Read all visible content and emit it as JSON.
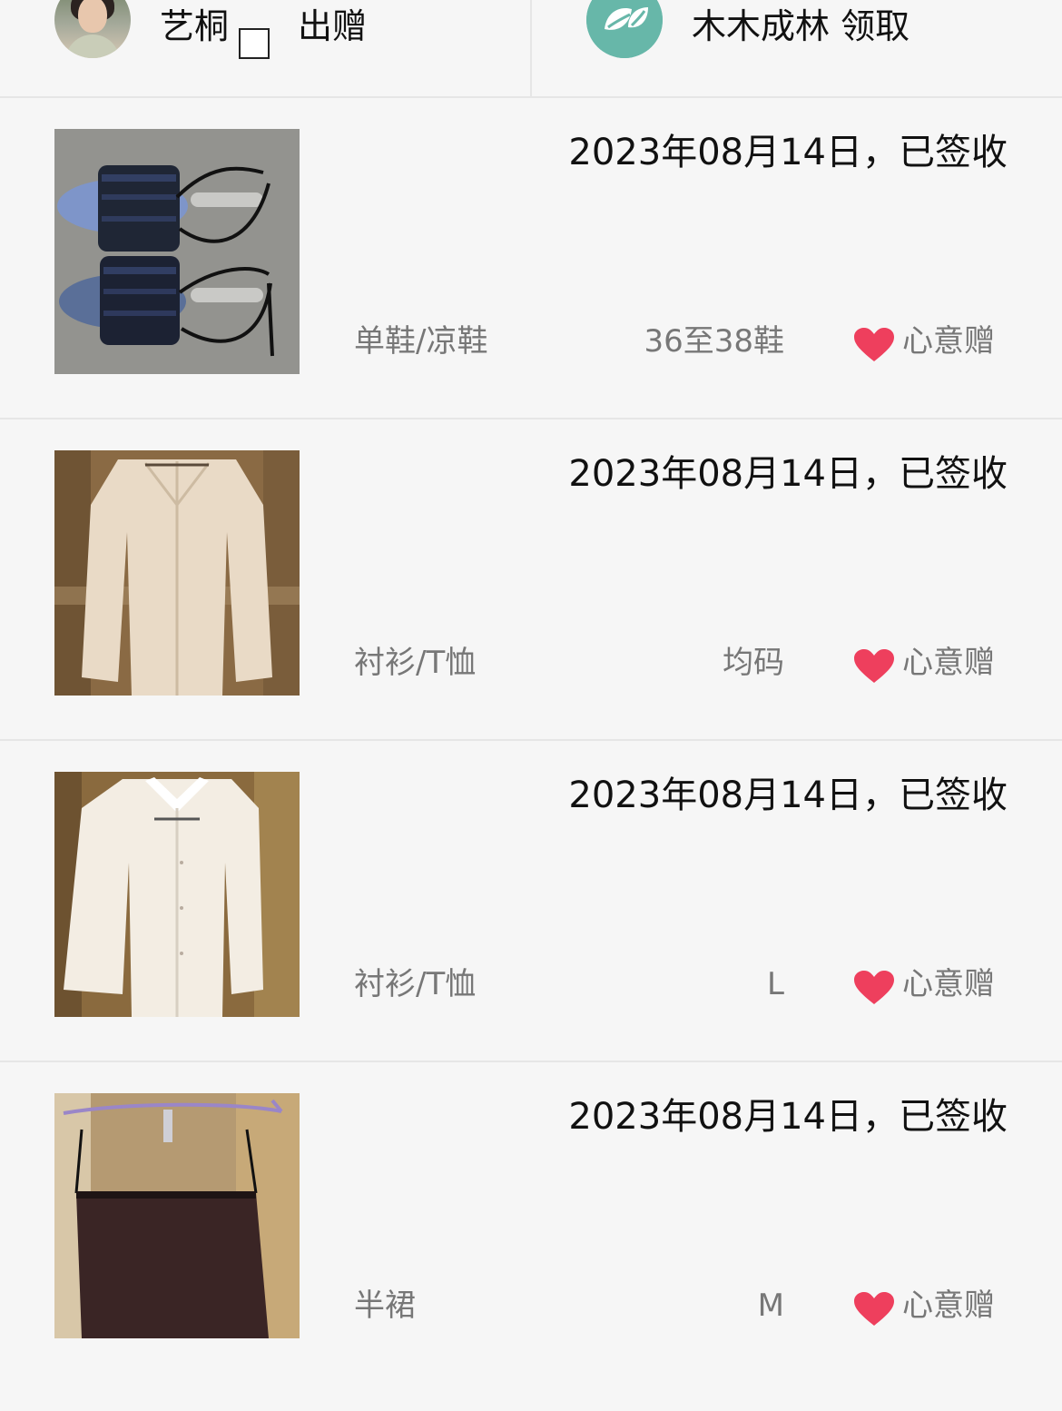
{
  "header": {
    "giver_name": "艺桐",
    "giver_action": "出赠",
    "receiver_text": "木木成林 领取"
  },
  "records": [
    {
      "date_status": "2023年08月14日，已签收",
      "category": "单鞋/凉鞋",
      "size": "36至38鞋",
      "tag": "心意赠",
      "image": "sandals-photo"
    },
    {
      "date_status": "2023年08月14日，已签收",
      "category": "衬衫/T恤",
      "size": "均码",
      "tag": "心意赠",
      "image": "cardigan-photo"
    },
    {
      "date_status": "2023年08月14日，已签收",
      "category": "衬衫/T恤",
      "size": "L",
      "tag": "心意赠",
      "image": "shirt-photo"
    },
    {
      "date_status": "2023年08月14日，已签收",
      "category": "半裙",
      "size": "M",
      "tag": "心意赠",
      "image": "skirt-photo"
    }
  ],
  "colors": {
    "background": "#f6f6f6",
    "heart": "#ee3f5d",
    "logo": "#67b7a9",
    "secondary_text": "#777777"
  }
}
